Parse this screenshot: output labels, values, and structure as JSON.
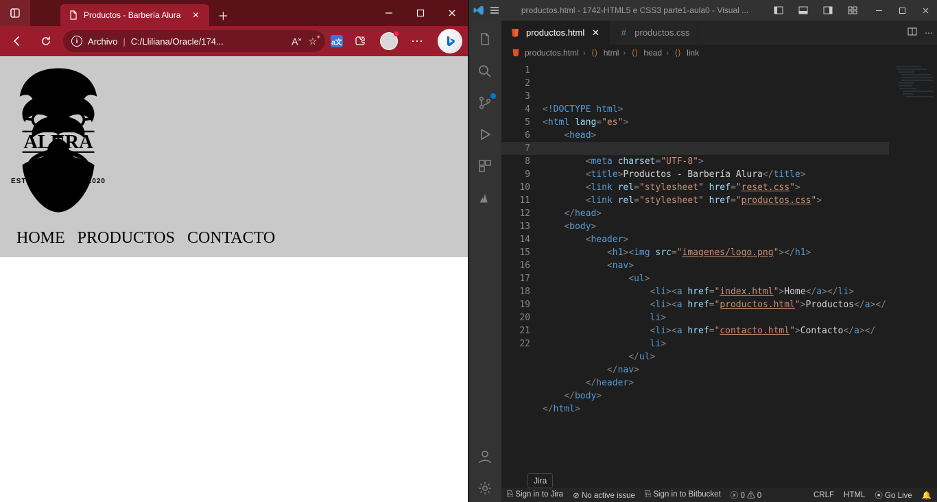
{
  "browser": {
    "tab_title": "Productos - Barbería Alura",
    "address_label": "Archivo",
    "address_path": "C:/Lliliana/Oracle/174...",
    "nav": {
      "home": "HOME",
      "productos": "PRODUCTOS",
      "contacto": "CONTACTO"
    },
    "logo": {
      "brand": "ALURA",
      "estd": "ESTD",
      "year": "2020"
    }
  },
  "vscode": {
    "title": "productos.html - 1742-HTML5 e CSS3 parte1-aula0 - Visual ...",
    "tabs": {
      "productos_html": "productos.html",
      "productos_css": "productos.css"
    },
    "breadcrumb": {
      "file": "productos.html",
      "html": "html",
      "head": "head",
      "link": "link"
    },
    "jira_tooltip": "Jira",
    "status": {
      "sign_jira": "Sign in to Jira",
      "no_issue": "No active issue",
      "sign_bb": "Sign in to Bitbucket",
      "err": "0",
      "warn": "0",
      "crlf": "CRLF",
      "lang": "HTML",
      "golive": "Go Live"
    },
    "code": {
      "l1": {
        "a": "<!",
        "b": "DOCTYPE",
        "c": " html",
        "d": ">"
      },
      "l2": {
        "a": "<",
        "b": "html",
        "c": " lang",
        "d": "=",
        "e": "\"es\"",
        "f": ">"
      },
      "l3": {
        "a": "<",
        "b": "head",
        "c": ">"
      },
      "l4": "",
      "l5": {
        "a": "<",
        "b": "meta",
        "c": " charset",
        "d": "=",
        "e": "\"UTF-8\"",
        "f": ">"
      },
      "l6": {
        "a": "<",
        "b": "title",
        "c": ">",
        "d": "Productos - Barbería Alura",
        "e": "</",
        "f": "title",
        "g": ">"
      },
      "l7": {
        "a": "<",
        "b": "link",
        "c": " rel",
        "d": "=",
        "e": "\"stylesheet\"",
        "f": " href",
        "g": "=",
        "h": "\"",
        "i": "reset.css",
        "j": "\"",
        "k": ">"
      },
      "l8": {
        "a": "<",
        "b": "link",
        "c": " rel",
        "d": "=",
        "e": "\"stylesheet\"",
        "f": " href",
        "g": "=",
        "h": "\"",
        "i": "productos.css",
        "j": "\"",
        "k": ">"
      },
      "l9": {
        "a": "</",
        "b": "head",
        "c": ">"
      },
      "l10": {
        "a": "<",
        "b": "body",
        "c": ">"
      },
      "l11": {
        "a": "<",
        "b": "header",
        "c": ">"
      },
      "l12": {
        "a": "<",
        "b": "h1",
        "c": "><",
        "d": "img",
        "e": " src",
        "f": "=",
        "g": "\"",
        "h": "imagenes/logo.png",
        "i": "\"",
        "j": "></",
        "k": "h1",
        "l": ">"
      },
      "l13": {
        "a": "<",
        "b": "nav",
        "c": ">"
      },
      "l14": {
        "a": "<",
        "b": "ul",
        "c": ">"
      },
      "l15": {
        "a": "<",
        "b": "li",
        "c": "><",
        "d": "a",
        "e": " href",
        "f": "=",
        "g": "\"",
        "h": "index.html",
        "i": "\"",
        "j": ">",
        "k": "Home",
        "l": "</",
        "m": "a",
        "n": "></",
        "o": "li",
        "p": ">"
      },
      "l16a": {
        "a": "<",
        "b": "li",
        "c": "><",
        "d": "a",
        "e": " href",
        "f": "=",
        "g": "\"",
        "h": "productos.html",
        "i": "\"",
        "j": ">",
        "k": "Productos",
        "l": "</",
        "m": "a",
        "n": "></"
      },
      "l16b": {
        "a": "li",
        "b": ">"
      },
      "l17a": {
        "a": "<",
        "b": "li",
        "c": "><",
        "d": "a",
        "e": " href",
        "f": "=",
        "g": "\"",
        "h": "contacto.html",
        "i": "\"",
        "j": ">",
        "k": "Contacto",
        "l": "</",
        "m": "a",
        "n": "></"
      },
      "l17b": {
        "a": "li",
        "b": ">"
      },
      "l18": {
        "a": "</",
        "b": "ul",
        "c": ">"
      },
      "l19": {
        "a": "</",
        "b": "nav",
        "c": ">"
      },
      "l20": {
        "a": "</",
        "b": "header",
        "c": ">"
      },
      "l21": {
        "a": "</",
        "b": "body",
        "c": ">"
      },
      "l22": {
        "a": "</",
        "b": "html",
        "c": ">"
      },
      "nums": [
        "1",
        "2",
        "3",
        "4",
        "5",
        "6",
        "7",
        "8",
        "9",
        "10",
        "11",
        "12",
        "13",
        "14",
        "15",
        "16",
        "",
        "17",
        "",
        "18",
        "19",
        "20",
        "21",
        "22"
      ]
    }
  }
}
